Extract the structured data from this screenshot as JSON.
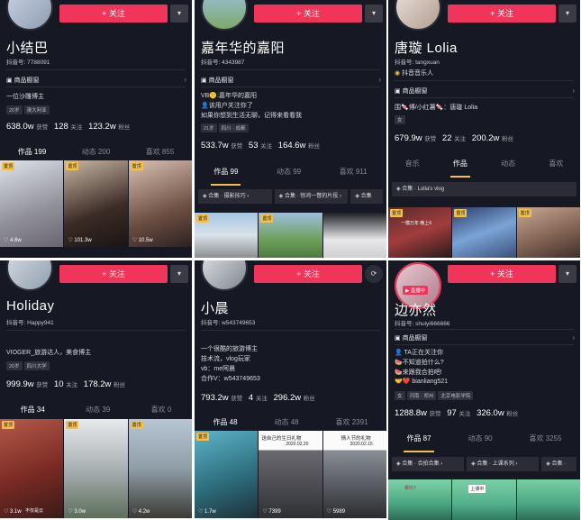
{
  "panels": [
    {
      "name": "小结巴",
      "uid": "抖音号: 7788091",
      "follow": "+ 关注",
      "more": "▾",
      "shop": "商品橱窗",
      "bio": [
        "一位沙雕博主"
      ],
      "tags": [
        "20岁",
        "澳大利亚"
      ],
      "stats": {
        "likes": "638.0w",
        "likes_l": "获赞",
        "following": "128",
        "following_l": "关注",
        "fans": "123.2w",
        "fans_l": "粉丝"
      },
      "tabs": [
        "作品 199",
        "动态 200",
        "喜欢 855"
      ],
      "thumbs": [
        {
          "pin": "置顶",
          "likes": "♡ 4.6w"
        },
        {
          "pin": "置顶",
          "likes": "♡ 101.3w"
        },
        {
          "pin": "置顶",
          "likes": "♡ 10.5w"
        }
      ]
    },
    {
      "name": "嘉年华的嘉阳",
      "uid": "抖音号: 4343987",
      "follow": "+ 关注",
      "more": "▾",
      "shop": "商品橱窗",
      "bio": [
        "VB🤫:嘉年华的嘉阳",
        "👤该用户关注你了",
        "如果你想到生活无聊，记得来看看我"
      ],
      "tags": [
        "21岁",
        "四川 · 成都"
      ],
      "stats": {
        "likes": "533.7w",
        "likes_l": "获赞",
        "following": "53",
        "following_l": "关注",
        "fans": "164.6w",
        "fans_l": "粉丝"
      },
      "tabs": [
        "作品 99",
        "动态 99",
        "喜欢 911"
      ],
      "collections": [
        "◈ 合集 · 摄影技巧 ›",
        "◈ 合集 · 惊鸿一瞥的片段 ›",
        "◈ 合集"
      ],
      "thumbs": [
        {
          "pin": "置顶",
          "likes": ""
        },
        {
          "pin": "置顶",
          "likes": ""
        },
        {
          "pin": "",
          "likes": ""
        }
      ]
    },
    {
      "name": "唐璇 Lolia",
      "uid": "抖音号: tangxuan",
      "follow": "+ 关注",
      "more": "▾",
      "verified": "抖音音乐人",
      "shop": "商品橱窗",
      "bio": [
        "围🍬博/小红薯🍬：唐璇 Lolia"
      ],
      "tags": [
        "女"
      ],
      "stats": {
        "likes": "679.9w",
        "likes_l": "获赞",
        "following": "22",
        "following_l": "关注",
        "fans": "200.2w",
        "fans_l": "粉丝"
      },
      "tabs": [
        "音乐",
        "作品",
        "动态",
        "喜欢"
      ],
      "collections": [
        "◈ 合集 · Lolia's vlog"
      ],
      "thumbs": [
        {
          "pin": "置顶",
          "likes": "",
          "cap": "一模万年 晚上6"
        },
        {
          "pin": "置顶",
          "likes": "",
          "cap": ""
        },
        {
          "pin": "置顶",
          "likes": "",
          "cap": ""
        }
      ]
    },
    {
      "name": "Holiday",
      "uid": "抖音号: Happy941",
      "follow": "+ 关注",
      "more": "▾",
      "bio": [
        "VIOGER_旅游达人，美食博主"
      ],
      "tags": [
        "20岁",
        "四川大学"
      ],
      "stats": {
        "likes": "999.9w",
        "likes_l": "获赞",
        "following": "10",
        "following_l": "关注",
        "fans": "178.2w",
        "fans_l": "粉丝"
      },
      "tabs": [
        "作品 34",
        "动态 39",
        "喜欢 0"
      ],
      "thumbs": [
        {
          "pin": "置顶",
          "likes": "♡ 3.1w",
          "cap": "不仅是云"
        },
        {
          "pin": "置顶",
          "likes": "♡ 3.0w"
        },
        {
          "pin": "置顶",
          "likes": "♡ 4.2w"
        }
      ]
    },
    {
      "name": "小晨",
      "uid": "抖音号: w543749653",
      "follow": "+ 关注",
      "more": "⟳",
      "bio": [
        "一个很酷的旅游博主",
        "技术流，vlog玩家",
        "vb：me阿晨",
        "合作V：w543749653"
      ],
      "stats": {
        "likes": "793.2w",
        "likes_l": "获赞",
        "following": "4",
        "following_l": "关注",
        "fans": "296.2w",
        "fans_l": "粉丝"
      },
      "tabs": [
        "作品 48",
        "动态 48",
        "喜欢 2391"
      ],
      "thumbs": [
        {
          "pin": "置顶",
          "likes": "♡ 1.7w",
          "cap": ""
        },
        {
          "pin": "",
          "likes": "♡ 7399",
          "cap": "送自己的生日礼物",
          "date": "2020.02.20"
        },
        {
          "pin": "",
          "likes": "♡ 5989",
          "cap": "情人节的礼物",
          "date": "2020.02.15"
        }
      ]
    },
    {
      "name": "边亦然",
      "uid": "抖音号: shuiyi666666",
      "follow": "+ 关注",
      "more": "▾",
      "live": "▶ 直播中",
      "shop": "商品橱窗",
      "bio": [
        "👤 TA正在关注你",
        "🍉不知道拍什么?",
        "🍉来跟我合拍吧!",
        "🤝❤️ bianliang521"
      ],
      "tags": [
        "女",
        "河南 · 郑州",
        "北京电影学院"
      ],
      "stats": {
        "likes": "1288.8w",
        "likes_l": "获赞",
        "following": "97",
        "following_l": "关注",
        "fans": "326.0w",
        "fans_l": "粉丝"
      },
      "tabs": [
        "作品 87",
        "动态 90",
        "喜欢 3255"
      ],
      "collections": [
        "◈ 合集 · 合拍合集 ›",
        "◈ 合集 · 上课系列 ›",
        "◈ 合集 ·"
      ],
      "thumbs": [
        {
          "pin": "",
          "likes": "",
          "cap": "哪吒?"
        },
        {
          "pin": "",
          "likes": "",
          "cap": "上课中"
        },
        {
          "pin": "",
          "likes": "",
          "cap": ""
        }
      ]
    }
  ],
  "colors": {
    "bg": "#161823",
    "accent": "#f1345a",
    "gold": "#f3c14b"
  },
  "icons": {
    "shop": "shop-bag-icon",
    "more": "dropdown-icon",
    "like": "heart-icon"
  }
}
